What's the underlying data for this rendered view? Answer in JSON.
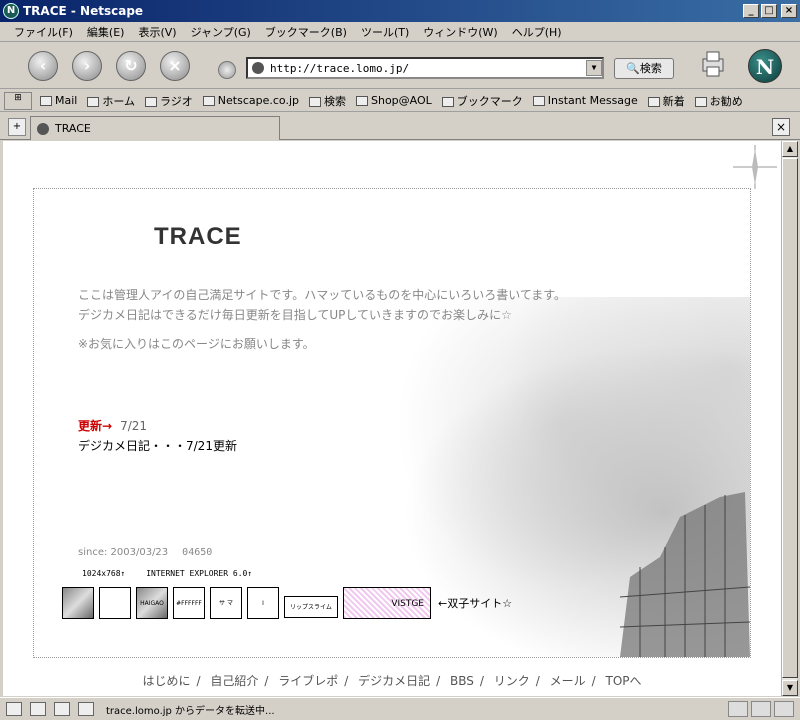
{
  "window": {
    "title": "TRACE - Netscape",
    "buttons": [
      "_",
      "□",
      "×"
    ]
  },
  "menu": [
    "ファイル(F)",
    "編集(E)",
    "表示(V)",
    "ジャンプ(G)",
    "ブックマーク(B)",
    "ツール(T)",
    "ウィンドウ(W)",
    "ヘルプ(H)"
  ],
  "nav": {
    "url": "http://trace.lomo.jp/",
    "search_label": "検索"
  },
  "personal_toolbar": [
    "Mail",
    "ホーム",
    "ラジオ",
    "Netscape.co.jp",
    "検索",
    "Shop@AOL",
    "ブックマーク",
    "Instant Message",
    "新着",
    "お勧め"
  ],
  "tab": {
    "label": "TRACE"
  },
  "page": {
    "site_title": "TRACE",
    "intro_line1": "ここは管理人アイの自己満足サイトです。ハマッているものを中心にいろいろ書いてます。",
    "intro_line2": "デジカメ日記はできるだけ毎日更新を目指してUPしていきますのでお楽しみに☆",
    "note": "※お気に入りはこのページにお願いします。",
    "update_label": "更新→",
    "update_date": "7/21",
    "diary_text": "デジカメ日記・・・7/21更新",
    "since": "since: 2003/03/23",
    "counter": "04650",
    "env_resolution": "1024x768↑",
    "env_browser": "INTERNET EXPLORER 6.0↑",
    "banners": [
      "",
      "",
      "HAIGAO",
      "#FFFFFF",
      "サ マ",
      "I",
      "リップスライム",
      "VISTGE"
    ],
    "sibling_text": "←双子サイト☆"
  },
  "footer_nav": [
    "はじめに",
    "自己紹介",
    "ライブレポ",
    "デジカメ日記",
    "BBS",
    "リンク",
    "メール",
    "TOPへ"
  ],
  "footer_sep": "/",
  "status": {
    "message": "trace.lomo.jp からデータを転送中..."
  }
}
